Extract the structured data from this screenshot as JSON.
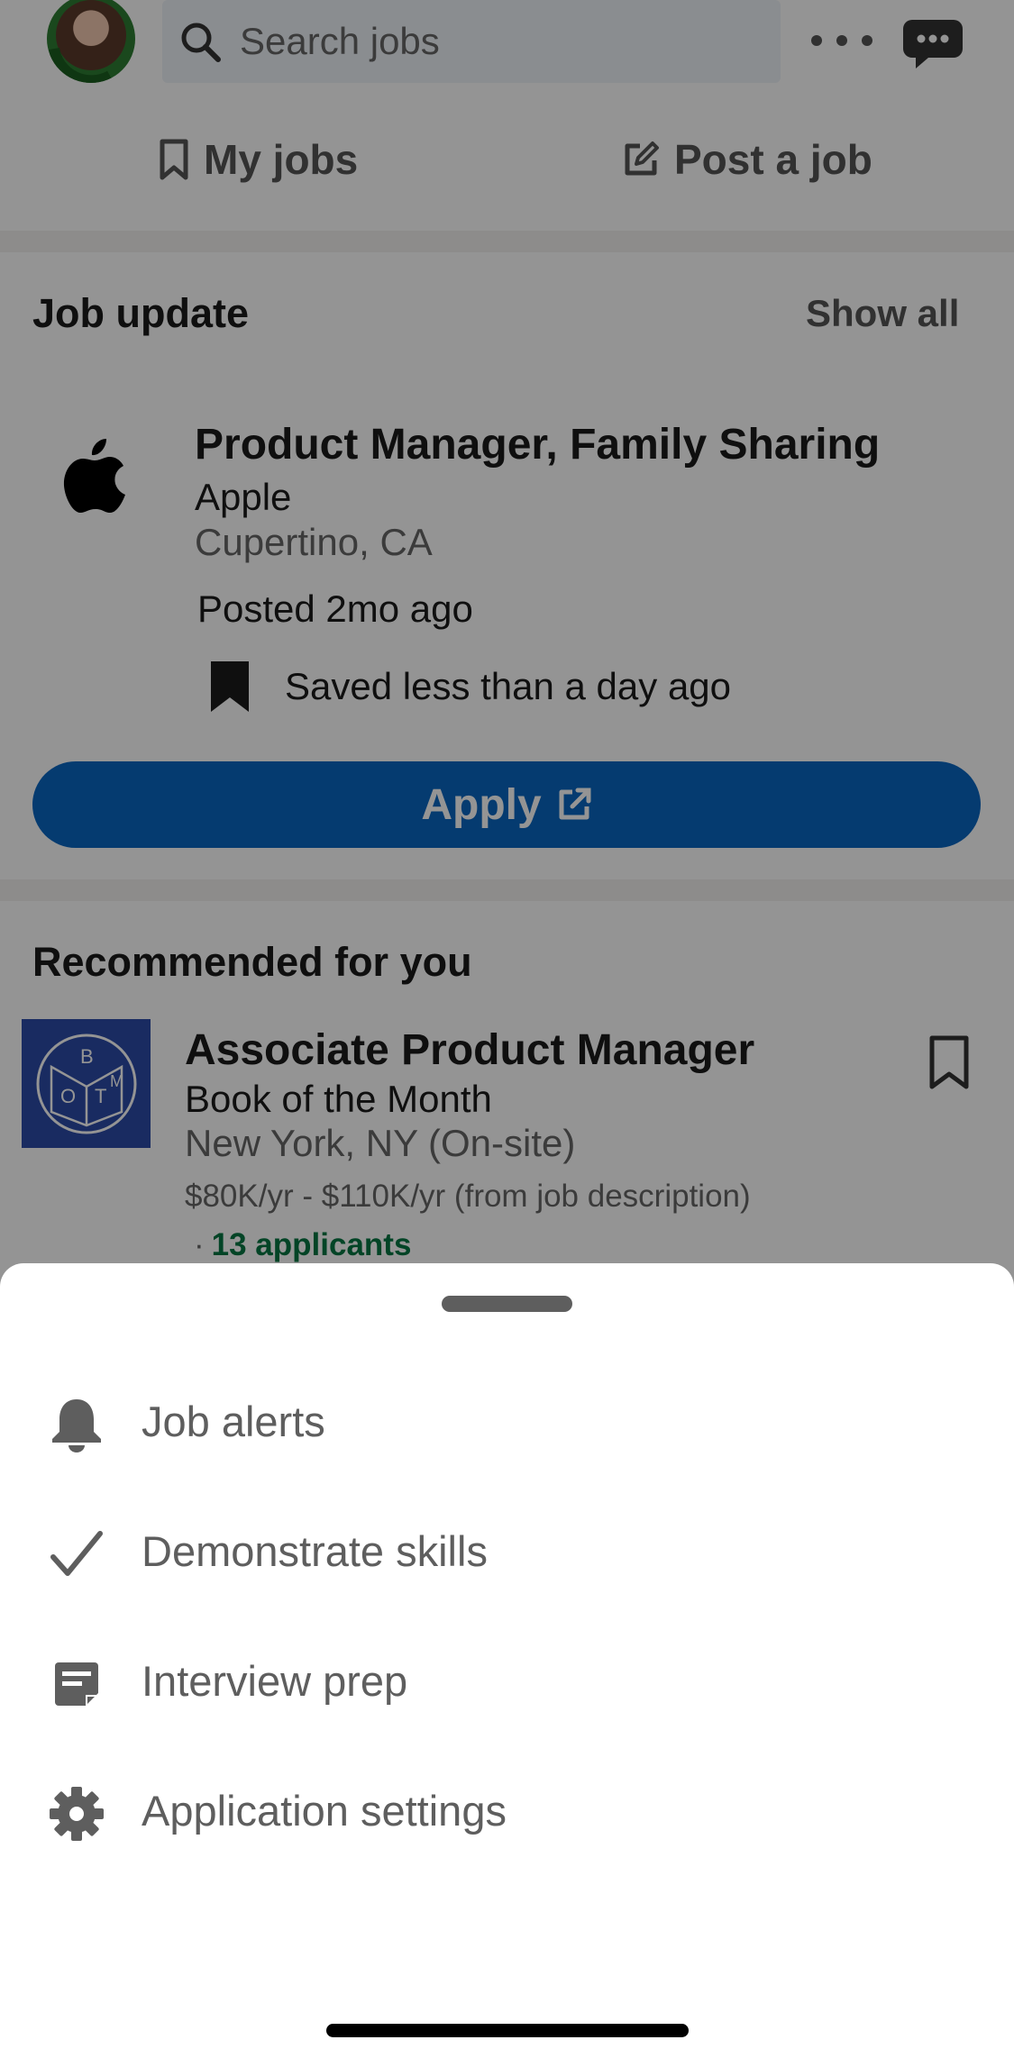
{
  "topbar": {
    "search_placeholder": "Search jobs",
    "avatar_badge": "OPENTOWORK",
    "icons": [
      "search-icon",
      "more-icon",
      "messaging-icon"
    ]
  },
  "tabs": {
    "my_jobs": "My jobs",
    "post_job": "Post a job"
  },
  "job_update": {
    "title": "Job update",
    "show_all": "Show all",
    "job_title": "Product Manager, Family Sharing",
    "company": "Apple",
    "location": "Cupertino, CA",
    "posted": "Posted 2mo ago",
    "saved": "Saved less than a day ago",
    "apply_label": "Apply"
  },
  "recommended": {
    "title": "Recommended for you",
    "job_title": "Associate Product Manager",
    "company": "Book of the Month",
    "location": "New York, NY (On-site)",
    "salary": "$80K/yr - $110K/yr (from job description)",
    "applicants_prefix": "·",
    "applicants": "13 applicants",
    "logo_letters": [
      "B",
      "O",
      "T",
      "M"
    ]
  },
  "sheet": {
    "items": [
      {
        "label": "Job alerts",
        "icon": "bell-icon"
      },
      {
        "label": "Demonstrate skills",
        "icon": "checkmark-icon"
      },
      {
        "label": "Interview prep",
        "icon": "note-icon"
      },
      {
        "label": "Application settings",
        "icon": "gear-icon"
      }
    ]
  },
  "colors": {
    "brand_blue": "#0a66c2",
    "applicant_green": "#057642",
    "overlay": "rgba(0,0,0,0.42)",
    "sheet_text": "#5e5e5e"
  }
}
